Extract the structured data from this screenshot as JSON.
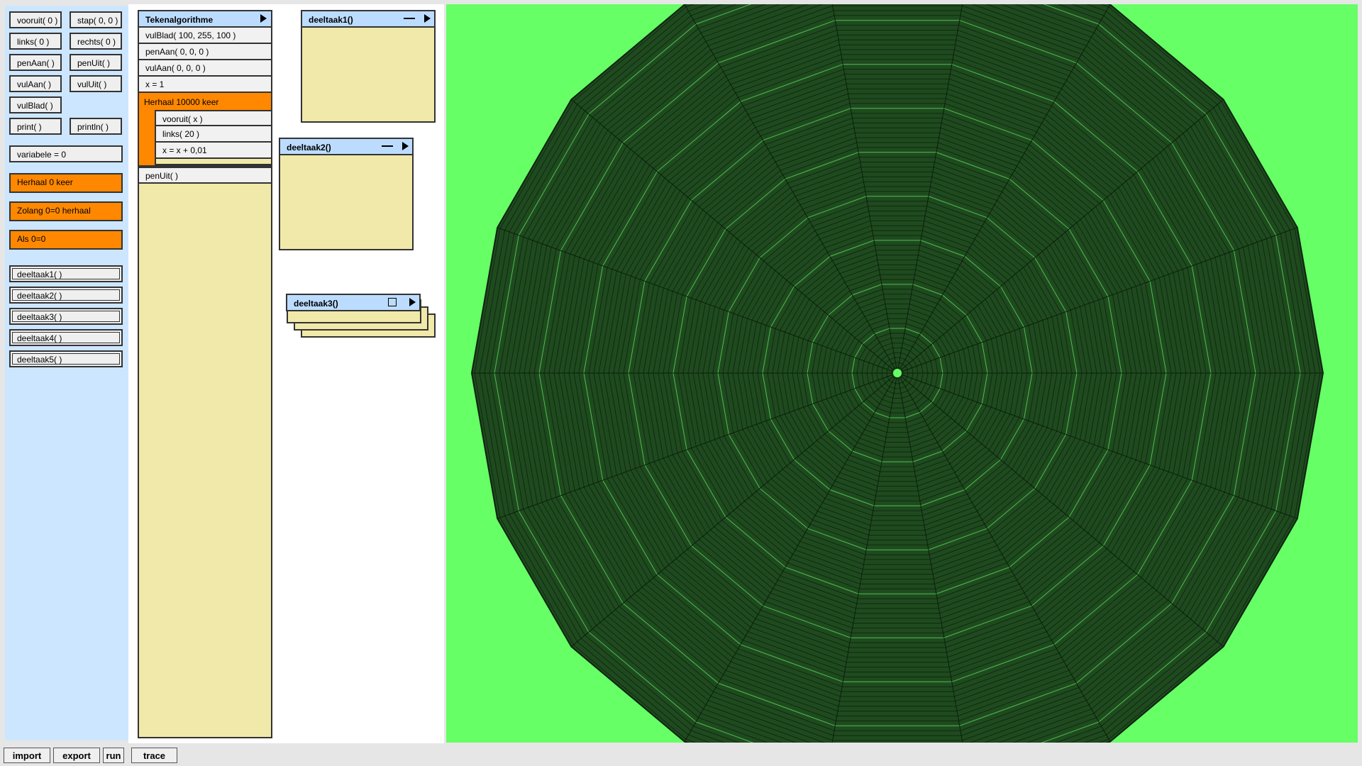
{
  "palette": {
    "vooruit": "vooruit( 0 )",
    "stap": "stap( 0, 0 )",
    "links": "links( 0 )",
    "rechts": "rechts( 0 )",
    "penAan": "penAan(  )",
    "penUit": "penUit(  )",
    "vulAan": "vulAan(  )",
    "vulUit": "vulUit(  )",
    "vulBlad": "vulBlad(  )",
    "print": "print(  )",
    "println": "println(  )",
    "variabele": "variabele = 0",
    "herhaal": "Herhaal 0 keer",
    "zolang": "Zolang 0=0 herhaal",
    "als": "Als 0=0",
    "deeltaak1": "deeltaak1(  )",
    "deeltaak2": "deeltaak2(  )",
    "deeltaak3": "deeltaak3(  )",
    "deeltaak4": "deeltaak4(  )",
    "deeltaak5": "deeltaak5(  )"
  },
  "algorithm": {
    "title": "Tekenalgorithme",
    "lines": [
      "vulBlad( 100, 255, 100 )",
      "penAan( 0, 0, 0 )",
      "vulAan( 0, 0, 0 )",
      "x = 1"
    ],
    "loop": {
      "header": "Herhaal 10000 keer",
      "lines": [
        "vooruit( x )",
        "links( 20 )",
        "x = x + 0,01"
      ]
    },
    "after": "penUit( )"
  },
  "subtasks": {
    "d1": "deeltaak1()",
    "d2": "deeltaak2()",
    "d3": "deeltaak3()"
  },
  "bottom": {
    "import": "import",
    "export": "export",
    "run": "run",
    "trace": "trace"
  },
  "colors": {
    "canvas_bg": "#66ff66",
    "drawing_fill": "#1f4a1f",
    "loop_orange": "#ff8800",
    "palette_bg": "#cce6ff",
    "block_body": "#f0e9a9",
    "header_blue": "#bcdcff"
  },
  "icons": {
    "play": "triangle-right",
    "minimize": "dash",
    "restore": "square"
  }
}
